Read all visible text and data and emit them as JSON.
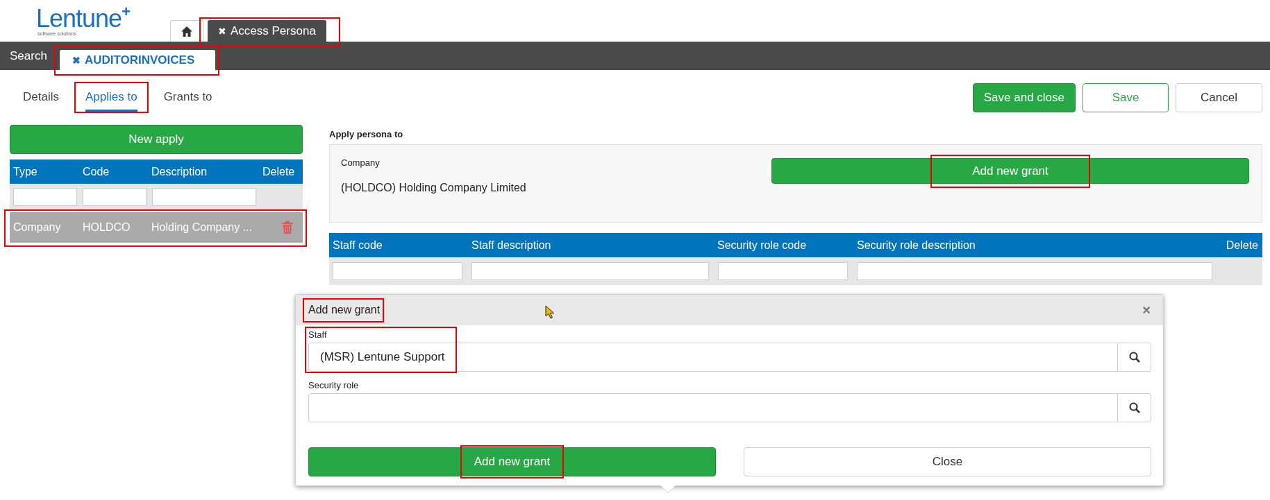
{
  "logo": {
    "text": "Lentune",
    "plus": "+",
    "tagline": "software solutions"
  },
  "top_tabs": [
    {
      "kind": "home",
      "selected": false,
      "highlighted": false
    },
    {
      "kind": "text",
      "close": "✖",
      "label": "Access Persona",
      "selected": true,
      "highlighted": true
    }
  ],
  "nav": {
    "search": "Search",
    "tabs": [
      {
        "close": "✖",
        "label": "AUDITORINVOICES",
        "selected": true,
        "highlighted": true
      }
    ]
  },
  "sub_tabs": [
    {
      "label": "Details",
      "selected": false,
      "highlighted": false
    },
    {
      "label": "Applies to",
      "selected": true,
      "highlighted": true
    },
    {
      "label": "Grants to",
      "selected": false,
      "highlighted": false
    }
  ],
  "actions": [
    {
      "label": "Save and close",
      "kind": "primary"
    },
    {
      "label": "Save",
      "kind": "outline"
    },
    {
      "label": "Cancel",
      "kind": "default"
    }
  ],
  "applies": {
    "new_button": "New apply",
    "columns": [
      "Type",
      "Code",
      "Description",
      "Delete"
    ],
    "rows": [
      {
        "type": "Company",
        "code": "HOLDCO",
        "description": "Holding Company ...",
        "selected": true,
        "highlighted": true
      }
    ]
  },
  "apply_panel": {
    "title": "Apply persona to",
    "label": "Company",
    "value": "(HOLDCO) Holding Company Limited",
    "button": {
      "label": "Add new grant",
      "highlighted": true
    }
  },
  "grants_table": {
    "columns": [
      "Staff code",
      "Staff description",
      "Security role code",
      "Security role description",
      "Delete"
    ]
  },
  "dialog": {
    "title": "Add new grant",
    "title_highlighted": true,
    "close": "×",
    "fields": [
      {
        "label": "Staff",
        "value": "(MSR) Lentune Support",
        "highlighted": true
      },
      {
        "label": "Security role",
        "highlighted": false
      }
    ],
    "buttons": [
      {
        "label": "Add new grant",
        "kind": "primary",
        "highlighted": true
      },
      {
        "label": "Close",
        "kind": "default",
        "highlighted": false
      }
    ]
  }
}
